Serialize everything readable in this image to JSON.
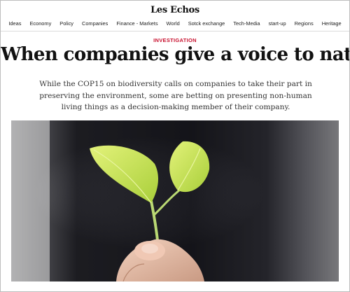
{
  "masthead": {
    "logo_text": "Les Echos"
  },
  "nav": {
    "items": [
      "Ideas",
      "Economy",
      "Policy",
      "Companies",
      "Finance - Markets",
      "World",
      "Sotck exchange",
      "Tech-Media",
      "start-up",
      "Regions",
      "Heritage"
    ]
  },
  "article": {
    "kicker": "INVESTIGATION",
    "headline": "When companies give a voice to nature",
    "lede": "While the COP15 on biodiversity calls on companies to take their part in preserving the environment, some are betting on presenting non-human living things as a decision-making member of their company."
  },
  "colors": {
    "accent": "#c8102e",
    "leaf": "#c9e65a",
    "background_dark": "#1c1c22"
  }
}
